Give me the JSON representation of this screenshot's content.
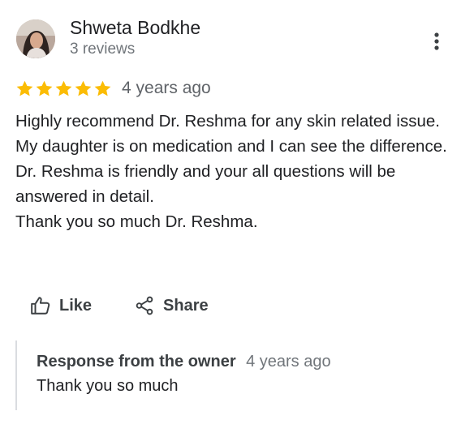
{
  "review": {
    "author": "Shweta Bodkhe",
    "author_meta": "3 reviews",
    "rating": 5,
    "rating_max": 5,
    "star_color": "#fbbc04",
    "time_ago": "4 years ago",
    "text": "Highly recommend Dr. Reshma for any skin related issue. My daughter is on medication and I can see the difference.\nDr. Reshma is friendly and your all questions will be answered in detail.\nThank you so much Dr. Reshma."
  },
  "actions": {
    "like_label": "Like",
    "share_label": "Share"
  },
  "owner_response": {
    "title": "Response from the owner",
    "time_ago": "4 years ago",
    "text": "Thank you so much"
  },
  "icons": {
    "more": "more-vert-icon",
    "like": "thumb-up-icon",
    "share": "share-icon",
    "star": "star-icon"
  }
}
